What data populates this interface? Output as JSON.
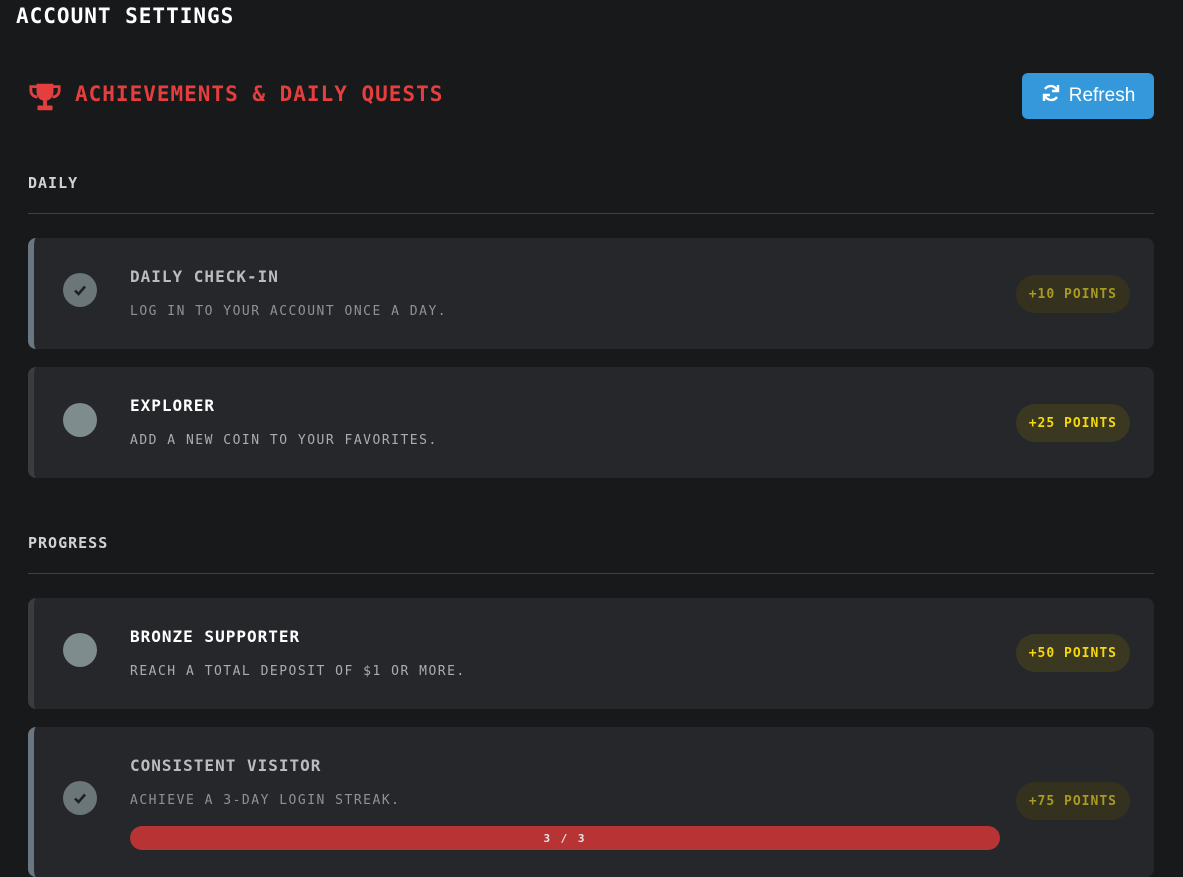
{
  "page": {
    "title": "Account Settings"
  },
  "section": {
    "title": "Achievements & Daily Quests",
    "refresh_label": "Refresh",
    "accent_color": "#e53e3e",
    "refresh_color": "#3498db"
  },
  "groups": [
    {
      "label": "Daily",
      "items": [
        {
          "title": "Daily Check-in",
          "description": "Log in to your account once a day.",
          "points": "+10 Points",
          "completed": true
        },
        {
          "title": "Explorer",
          "description": "Add a new coin to your favorites.",
          "points": "+25 Points",
          "completed": false
        }
      ]
    },
    {
      "label": "Progress",
      "items": [
        {
          "title": "Bronze Supporter",
          "description": "Reach a total deposit of $1 or more.",
          "points": "+50 Points",
          "completed": false
        },
        {
          "title": "Consistent Visitor",
          "description": "Achieve a 3-day login streak.",
          "points": "+75 Points",
          "completed": true,
          "progress": {
            "current": 3,
            "total": 3,
            "text": "3 / 3"
          }
        }
      ]
    }
  ],
  "icons": {
    "trophy": "trophy-icon",
    "refresh": "sync-icon",
    "check": "check-icon"
  }
}
